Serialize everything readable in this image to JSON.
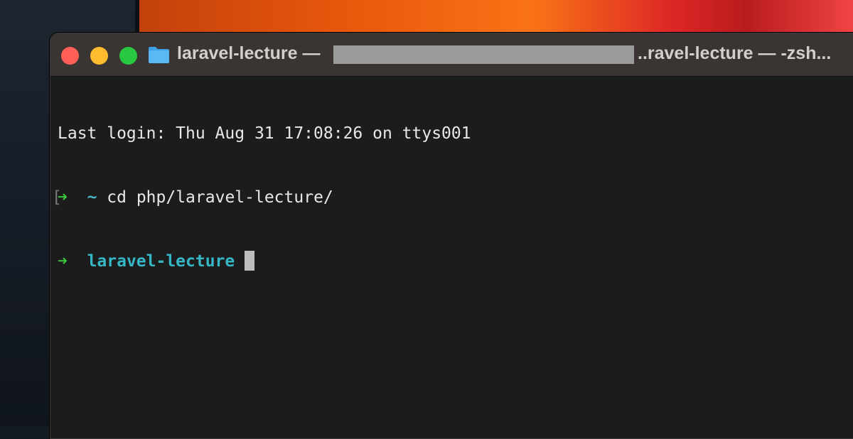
{
  "window": {
    "title_left": "laravel-lecture —",
    "title_right": "..ravel-lecture — -zsh..."
  },
  "terminal": {
    "lines": [
      {
        "text": "Last login: Thu Aug 31 17:08:26 on ttys001"
      },
      {
        "marker": "[",
        "prompt": "➜",
        "cwd": "~",
        "command": "cd php/laravel-lecture/"
      },
      {
        "prompt": "➜",
        "cwd": "laravel-lecture",
        "command": ""
      }
    ]
  },
  "colors": {
    "prompt_arrow": "#39c639",
    "cwd": "#35b7c6",
    "background": "#1c1c1c",
    "titlebar": "#3a3533"
  },
  "icons": {
    "title_icon": "folder-icon"
  }
}
